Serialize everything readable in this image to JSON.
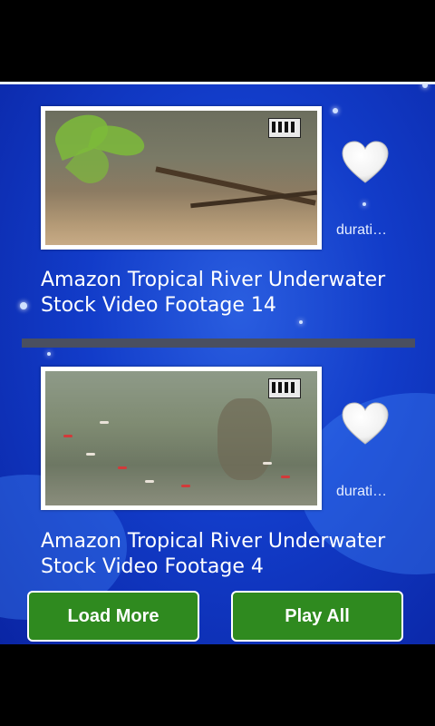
{
  "videos": [
    {
      "title": "Amazon Tropical River Underwater Stock Video Footage 14",
      "duration": "durati…",
      "thumbnail_icon": "video-thumbnail",
      "favorite_icon": "heart-icon"
    },
    {
      "title": "Amazon Tropical River Underwater Stock Video Footage 4",
      "duration": "durati…",
      "thumbnail_icon": "video-thumbnail",
      "favorite_icon": "heart-icon"
    }
  ],
  "actions": {
    "load_more_label": "Load More",
    "play_all_label": "Play All"
  },
  "colors": {
    "background": "#123cc9",
    "button": "#2f8a1f",
    "divider": "#4a4f60"
  }
}
